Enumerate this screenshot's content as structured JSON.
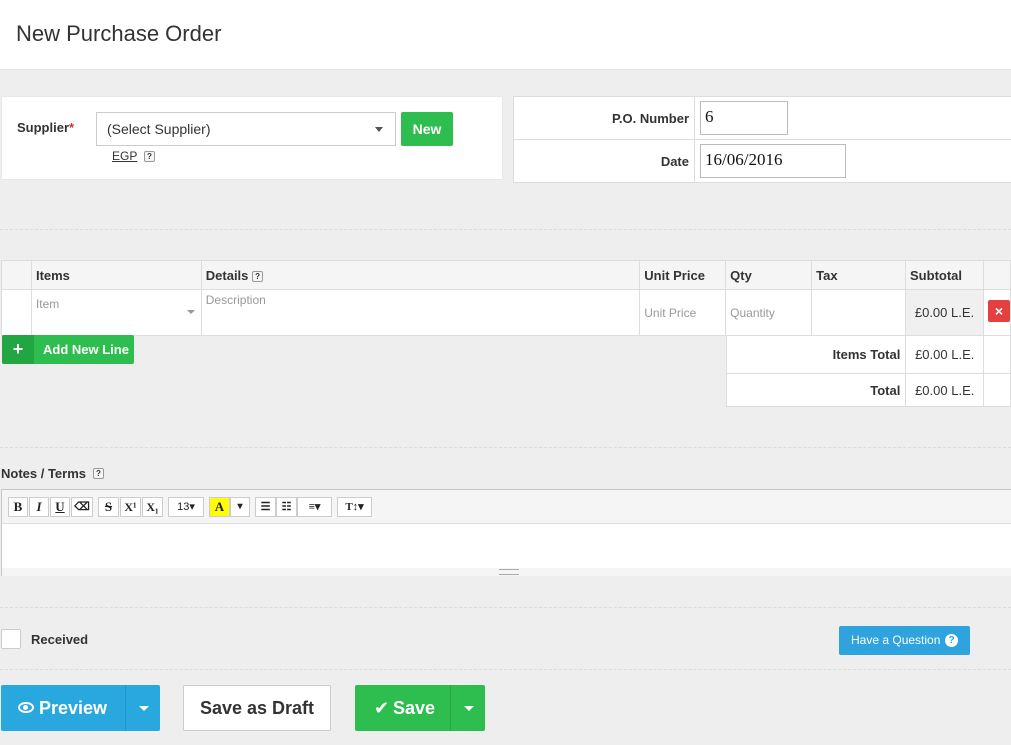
{
  "page": {
    "title": "New Purchase Order"
  },
  "supplier": {
    "label": "Supplier",
    "required_mark": "*",
    "select_value": "(Select Supplier)",
    "new_button": "New",
    "currency": "EGP",
    "help": "?"
  },
  "po": {
    "number_label": "P.O. Number",
    "number_value": "6",
    "date_label": "Date",
    "date_value": "16/06/2016"
  },
  "items": {
    "headers": {
      "items": "Items",
      "details": "Details",
      "unit_price": "Unit Price",
      "qty": "Qty",
      "tax": "Tax",
      "subtotal": "Subtotal"
    },
    "details_help": "?",
    "row": {
      "item_placeholder": "Item",
      "description_placeholder": "Description",
      "unit_price_placeholder": "Unit Price",
      "quantity_placeholder": "Quantity",
      "subtotal": "£0.00 L.E.",
      "delete_icon": "×"
    },
    "add_line_label": "Add New Line",
    "add_line_icon": "+"
  },
  "totals": {
    "items_total_label": "Items Total",
    "items_total_value": "£0.00 L.E.",
    "total_label": "Total",
    "total_value": "£0.00 L.E."
  },
  "notes": {
    "label": "Notes / Terms",
    "help": "?",
    "toolbar": {
      "bold": "B",
      "italic": "I",
      "underline": "U",
      "eraser": "⌫",
      "strike": "S",
      "superscript": "X¹",
      "subscript": "X₁",
      "font_size": "13▾",
      "color": "A",
      "color_caret": "▾",
      "ul": "☰",
      "ol": "☷",
      "align": "≡▾",
      "text_style": "T↕▾"
    }
  },
  "footer": {
    "received_label": "Received",
    "question_button": "Have a Question",
    "question_icon": "?",
    "preview_button": "Preview",
    "draft_button": "Save as Draft",
    "save_button": "Save",
    "save_icon": "✔"
  },
  "colors": {
    "green": "#2ebd4f",
    "blue": "#29a7df",
    "red": "#e54040"
  }
}
